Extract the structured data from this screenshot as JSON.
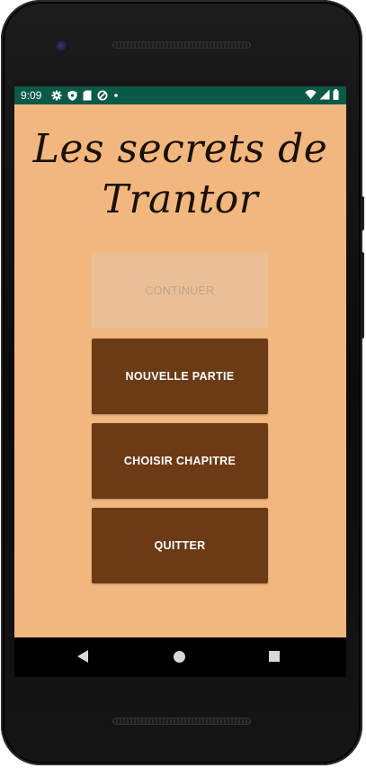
{
  "status_bar": {
    "time": "9:09",
    "left_icons": [
      "gear-icon",
      "shield-icon",
      "sd-card-icon",
      "data-saver-icon",
      "dot-icon"
    ],
    "right_icons": [
      "wifi-icon",
      "signal-icon",
      "battery-icon"
    ],
    "background": "#0b5a48"
  },
  "app": {
    "title_line1": "Les secrets de",
    "title_line2": "Trantor",
    "background": "#f2b77e"
  },
  "menu": {
    "continue_label": "CONTINUER",
    "new_game_label": "NOUVELLE PARTIE",
    "choose_chapter_label": "CHOISIR CHAPITRE",
    "quit_label": "QUITTER",
    "button_color": "#6b3b16",
    "disabled_color": "#ebbf95"
  },
  "nav_bar": {
    "icons": [
      "back-icon",
      "home-icon",
      "recents-icon"
    ]
  }
}
